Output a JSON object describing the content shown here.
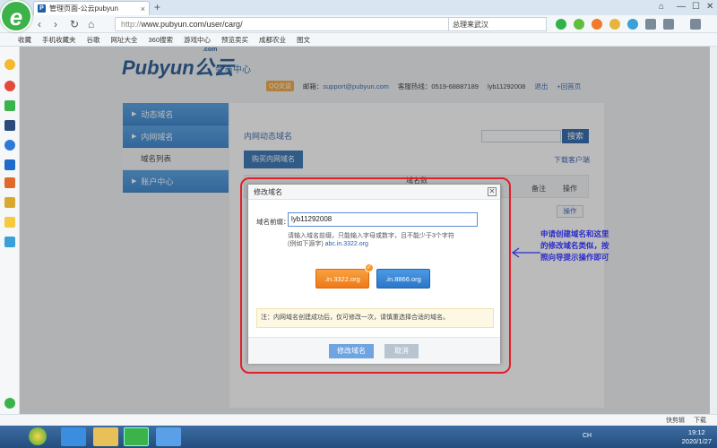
{
  "browser": {
    "tab_title": "管理页面-公云pubyun",
    "favicon_letter": "P",
    "url_scheme": "http://",
    "url_rest": "www.pubyun.com/user/carg/",
    "search_text": "总理来武汉",
    "logo_letter": "e"
  },
  "favbar": {
    "items": [
      "收藏",
      "手机收藏夹",
      "谷歌",
      "网址大全",
      "360搜索",
      "游戏中心",
      "预览卖买",
      "成都农业",
      "图文"
    ]
  },
  "site": {
    "logo_main": "Pubyun",
    "logo_cn": "公云",
    "logo_com": ".com",
    "logo_sub": "会员中心",
    "qq_label": "QQ交谈",
    "email_label": "邮箱：",
    "email": "support@pubyun.com",
    "hotline_label": "客服热线：0519-68887189",
    "username": "lyb11292008",
    "logout": "退出",
    "home": "+回首页"
  },
  "sidenav": {
    "dynamic": "动态域名",
    "intranet": "内网域名",
    "domain_list": "域名列表",
    "account": "账户中心"
  },
  "main": {
    "title": "内网动态域名",
    "search_button": "搜索",
    "buy_button": "购买内网域名",
    "download": "下载客户端",
    "col_domain": "域名数",
    "col_remark": "备注",
    "col_op": "操作",
    "op_button": "操作"
  },
  "modal": {
    "title": "修改域名",
    "close": "✕",
    "prefix_label": "域名前缀：",
    "prefix_value": "lyb11292008",
    "hint_line1": "请输入域名前缀，只能输入字母或数字，且不能少于3个字符",
    "hint_line2_prefix": "(例如下源字)",
    "hint_example": "abc.in.3322.org",
    "domain_a": ".in.3322.org",
    "domain_b": ".in.8866.org",
    "notice": "注：内网域名创建成功后，仅可修改一次，请慎重选择合适的域名。",
    "confirm": "修改域名",
    "cancel": "取消"
  },
  "annotation": {
    "text": "申请创建域名和这里的修改域名类似，按照向导提示操作即可",
    "color": "#e0202a"
  },
  "statusbar": {
    "items": [
      "快剪辑",
      "下载"
    ]
  },
  "taskbar": {
    "time": "19:12",
    "date": "2020/1/27",
    "lang": "CH"
  }
}
